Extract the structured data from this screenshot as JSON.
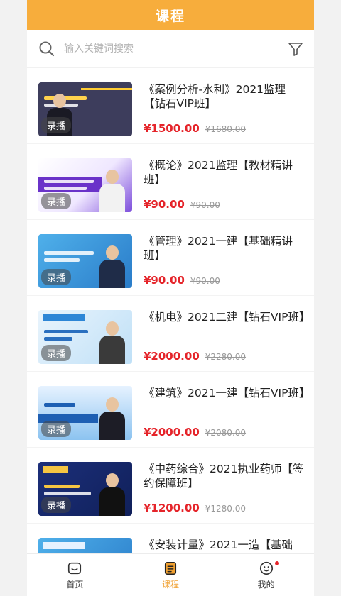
{
  "header": {
    "title": "课程"
  },
  "search": {
    "placeholder": "输入关键词搜索"
  },
  "courses": [
    {
      "title": "《案例分析-水利》2021监理【钻石VIP班】",
      "price": "¥1500.00",
      "old_price": "¥1680.00",
      "tag": "录播",
      "theme": "dark"
    },
    {
      "title": "《概论》2021监理【教材精讲班】",
      "price": "¥90.00",
      "old_price": "¥90.00",
      "tag": "录播",
      "theme": "purple"
    },
    {
      "title": "《管理》2021一建【基础精讲班】",
      "price": "¥90.00",
      "old_price": "¥90.00",
      "tag": "录播",
      "theme": "blue"
    },
    {
      "title": "《机电》2021二建【钻石VIP班】",
      "price": "¥2000.00",
      "old_price": "¥2280.00",
      "tag": "录播",
      "theme": "lightblue"
    },
    {
      "title": "《建筑》2021一建【钻石VIP班】",
      "price": "¥2000.00",
      "old_price": "¥2080.00",
      "tag": "录播",
      "theme": "sky"
    },
    {
      "title": "《中药综合》2021执业药师【签约保障班】",
      "price": "¥1200.00",
      "old_price": "¥1280.00",
      "tag": "录播",
      "theme": "navy"
    },
    {
      "title": "《安装计量》2021一造【基础",
      "price": "",
      "old_price": "",
      "tag": "",
      "theme": "blue"
    }
  ],
  "tabbar": {
    "home": "首页",
    "courses": "课程",
    "mine": "我的"
  },
  "colors": {
    "accent": "#f7ad3c",
    "price": "#e5242a",
    "active_tab": "#f0a030"
  },
  "icons": {
    "search": "search-icon",
    "filter": "filter-icon",
    "home": "home-icon",
    "courses": "book-icon",
    "mine": "smiley-icon"
  }
}
